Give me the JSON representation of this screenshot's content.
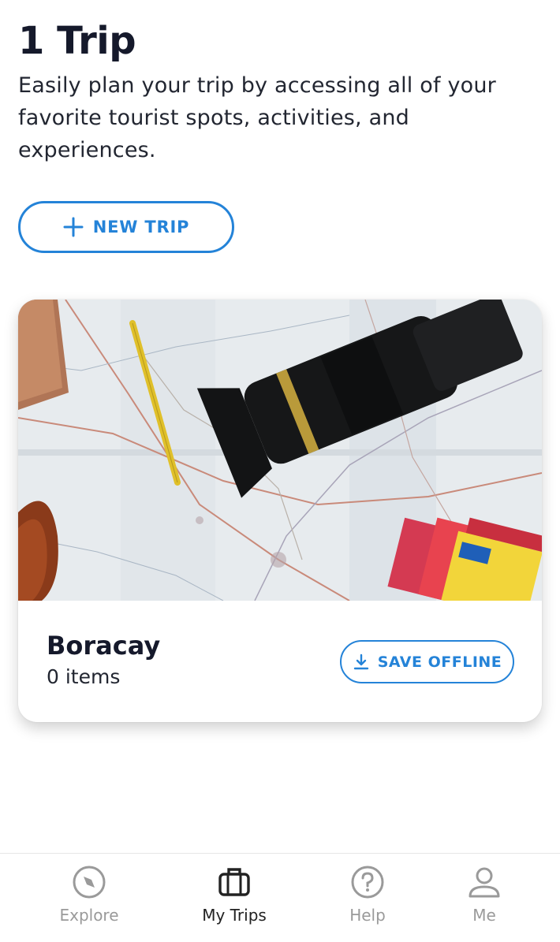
{
  "header": {
    "title": "1 Trip",
    "subtitle": "Easily plan your trip by accessing all of your favorite tourist spots, activities, and experiences."
  },
  "actions": {
    "new_trip_label": "NEW TRIP"
  },
  "trips": [
    {
      "name": "Boracay",
      "count": "0 items",
      "save_label": "SAVE OFFLINE"
    }
  ],
  "tabbar": {
    "items": [
      {
        "label": "Explore",
        "icon": "compass-icon",
        "active": false
      },
      {
        "label": "My Trips",
        "icon": "suitcase-icon",
        "active": true
      },
      {
        "label": "Help",
        "icon": "question-circle-icon",
        "active": false
      },
      {
        "label": "Me",
        "icon": "person-icon",
        "active": false
      }
    ]
  },
  "colors": {
    "accent": "#2483d8",
    "active_tab": "#222222",
    "inactive_tab": "#9a9a9a"
  }
}
